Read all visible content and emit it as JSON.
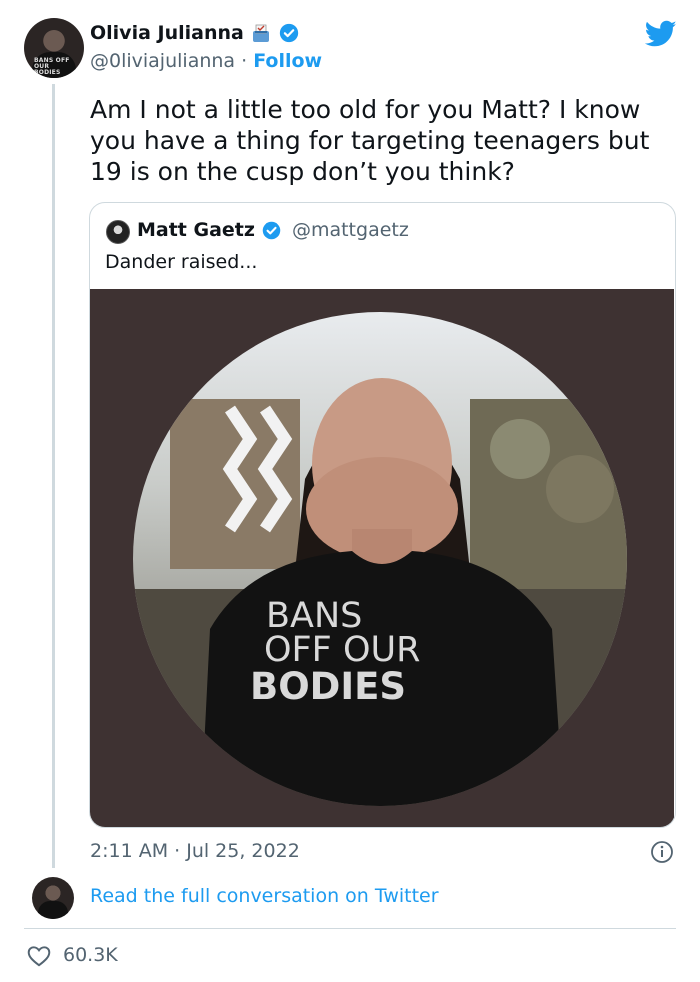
{
  "tweet": {
    "author_name": "Olivia Julianna",
    "author_handle": "@0liviajulianna",
    "separator": "·",
    "follow_label": "Follow",
    "text": "Am I not a little too old for you Matt? I know you have a thing for targeting teenagers but 19 is on the cusp don’t you think?",
    "timestamp": "2:11 AM · Jul 25, 2022",
    "read_more": "Read the full conversation on Twitter",
    "like_count": "60.3K"
  },
  "avatar": {
    "shirt_text": "BANS OFF OUR BODIES"
  },
  "quoted": {
    "author_name": "Matt Gaetz",
    "author_handle": "@mattgaetz",
    "text": "Dander raised...",
    "image_text": [
      "BANS",
      "OFF OUR",
      "BODIES"
    ]
  },
  "colors": {
    "link_blue": "#1d9bf0",
    "secondary_text": "#536471",
    "border": "#cfd9de",
    "image_background": "#3e3232"
  },
  "icons": {
    "brand": "twitter-bird-icon",
    "verified": "verified-badge-icon",
    "emoji": "ballot-box-emoji-icon",
    "info": "info-icon",
    "like": "heart-icon"
  }
}
